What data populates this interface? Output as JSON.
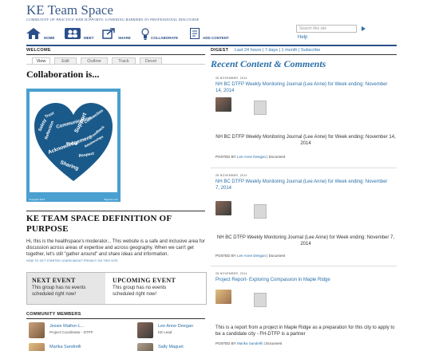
{
  "site": {
    "title": "KE Team Space",
    "tagline": "COMMUNITY OF PRACTICE WEB SUPPORTS: LOWERING BARRIERS TO PROFESSIONAL DISCOURSE",
    "search_placeholder": "Search this site",
    "help": "Help"
  },
  "nav": [
    {
      "label": "HOME",
      "icon": "home-icon"
    },
    {
      "label": "MEET",
      "icon": "people-icon"
    },
    {
      "label": "SHARE",
      "icon": "share-icon"
    },
    {
      "label": "COLLABORATE",
      "icon": "lightbulb-icon"
    },
    {
      "label": "ADD CONTENT",
      "icon": "add-content-icon"
    }
  ],
  "welcome": {
    "header": "WELCOME",
    "tabs": [
      "View",
      "Edit",
      "Outline",
      "Track",
      "Devel"
    ],
    "active_tab": "View",
    "title": "Collaboration is...",
    "image_caption_left": "Copyright 2014",
    "image_caption_right": "Tagxedo.com",
    "wordcloud": [
      "Acknowledgement",
      "Communication",
      "Sharing",
      "Support",
      "Connection",
      "Reflection",
      "Feedback",
      "Safety",
      "Respect",
      "Mutual",
      "Trust",
      "Relationships"
    ]
  },
  "definition": {
    "title": "KE TEAM SPACE DEFINITION OF PURPOSE",
    "body": "Hi, this is the healthspace's moderator...  This website is a safe and inclusive area for discussion across areas of expertise and across geography.  When we can't get together, let's still \"gather around\" and share ideas and information.",
    "links": "HOW TO GET STARTED   LEARN ABOUT PRIVACY ON THIS SITE"
  },
  "events": {
    "next_title": "NEXT EVENT",
    "next_text": "This group has no events scheduled right now!",
    "upcoming_title": "UPCOMING EVENT",
    "upcoming_text": "This group has no events scheduled right now!"
  },
  "members": {
    "header": "COMMUNITY MEMBERS",
    "list": [
      {
        "name": "Jessie Mather-L...",
        "role": "Project Coordinator - DTFP"
      },
      {
        "name": "Lee Anne Deegan",
        "role": "KE Lead"
      },
      {
        "name": "Marika Sandrelli",
        "role": ""
      },
      {
        "name": "Sally Maguet",
        "role": ""
      }
    ]
  },
  "digest": {
    "header": "DIGEST",
    "links": "Last 24 hours | 7 days | 1 month | Subscribe",
    "title": "Recent Content & Comments"
  },
  "posts": [
    {
      "date": "28 NOVEMBER, 2014",
      "title": "NH BC DTFP Weekly Monitoring Journal (Lee Anne) for Week ending: November 14, 2014",
      "desc": "NH BC DTFP Weekly Monitoring Journal (Lee Anne) for Week ending: November 14, 2014",
      "posted_by_label": "POSTED BY",
      "author": "Lee Anne Deegan",
      "type": "| Document"
    },
    {
      "date": "28 NOVEMBER, 2014",
      "title": "NH BC DTFP Weekly Monitoring Journal (Lee Anne) for Week ending: November 7, 2014",
      "desc": "NH BC DTFP Weekly Monitoring Journal (Lee Anne) for Week ending: November 7, 2014",
      "posted_by_label": "POSTED BY",
      "author": "Lee Anne Deegan",
      "type": "| Document"
    },
    {
      "date": "28 NOVEMBER, 2014",
      "title": "Project Report- Exploring Compassion in Maple Ridge",
      "desc": "This is a report from a project in Maple Ridge as a preparation for this city to apply to be a candidate city - FH-DTFP is a partner",
      "posted_by_label": "POSTED BY",
      "author": "Marika Sandrelli",
      "type": "| Document"
    }
  ],
  "colors": {
    "brand": "#2a4f8a",
    "link": "#2a6fa8",
    "heart": "#1a5a8a",
    "frame": "#4aa0d0"
  }
}
